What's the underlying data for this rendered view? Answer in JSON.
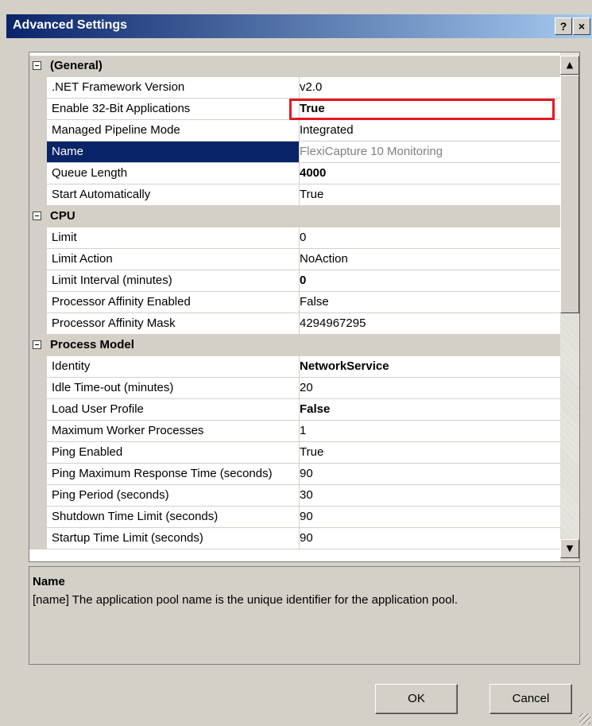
{
  "window": {
    "title": "Advanced Settings",
    "help_label": "?",
    "close_label": "×"
  },
  "grid": {
    "categories": [
      {
        "label": "(General)",
        "props": [
          {
            "name": ".NET Framework Version",
            "value": "v2.0"
          },
          {
            "name": "Enable 32-Bit Applications",
            "value": "True"
          },
          {
            "name": "Managed Pipeline Mode",
            "value": "Integrated"
          },
          {
            "name": "Name",
            "value": "FlexiCapture 10 Monitoring"
          },
          {
            "name": "Queue Length",
            "value": "4000"
          },
          {
            "name": "Start Automatically",
            "value": "True"
          }
        ]
      },
      {
        "label": "CPU",
        "props": [
          {
            "name": "Limit",
            "value": "0"
          },
          {
            "name": "Limit Action",
            "value": "NoAction"
          },
          {
            "name": "Limit Interval (minutes)",
            "value": "0"
          },
          {
            "name": "Processor Affinity Enabled",
            "value": "False"
          },
          {
            "name": "Processor Affinity Mask",
            "value": "4294967295"
          }
        ]
      },
      {
        "label": "Process Model",
        "props": [
          {
            "name": "Identity",
            "value": "NetworkService"
          },
          {
            "name": "Idle Time-out (minutes)",
            "value": "20"
          },
          {
            "name": "Load User Profile",
            "value": "False"
          },
          {
            "name": "Maximum Worker Processes",
            "value": "1"
          },
          {
            "name": "Ping Enabled",
            "value": "True"
          },
          {
            "name": "Ping Maximum Response Time (seconds)",
            "value": "90"
          },
          {
            "name": "Ping Period (seconds)",
            "value": "30"
          },
          {
            "name": "Shutdown Time Limit (seconds)",
            "value": "90"
          },
          {
            "name": "Startup Time Limit (seconds)",
            "value": "90"
          }
        ]
      }
    ]
  },
  "description": {
    "title": "Name",
    "text": "[name] The application pool name is the unique identifier for the application pool."
  },
  "buttons": {
    "ok": "OK",
    "cancel": "Cancel"
  }
}
